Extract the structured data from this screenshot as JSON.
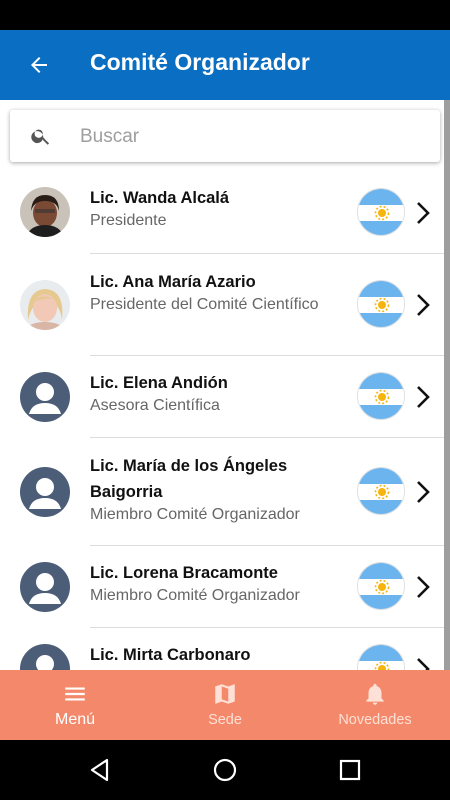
{
  "header": {
    "title": "Comité Organizador"
  },
  "search": {
    "placeholder": "Buscar",
    "value": ""
  },
  "members": [
    {
      "name": "Lic. Wanda Alcalá",
      "role": "Presidente"
    },
    {
      "name": "Lic. Ana María Azario",
      "role": "Presidente del Comité Científico"
    },
    {
      "name": "Lic. Elena Andión",
      "role": "Asesora Científica"
    },
    {
      "name": "Lic. María de los Ángeles Baigorria",
      "role": "Miembro Comité Organizador"
    },
    {
      "name": "Lic. Lorena Bracamonte",
      "role": "Miembro Comité Organizador"
    },
    {
      "name": "Lic. Mirta Carbonaro",
      "role": ""
    }
  ],
  "nav": {
    "items": [
      {
        "label": "Menú",
        "icon": "menu-icon",
        "active": true
      },
      {
        "label": "Sede",
        "icon": "map-icon",
        "active": false
      },
      {
        "label": "Novedades",
        "icon": "bell-icon",
        "active": false
      }
    ]
  },
  "colors": {
    "app_bar": "#0a6fc2",
    "bottom_nav": "#f4886a",
    "avatar_default": "#4b5d77",
    "flag_blue": "#6cb4ee",
    "flag_sun": "#f6b40e"
  },
  "flag": "argentina-flag-icon"
}
